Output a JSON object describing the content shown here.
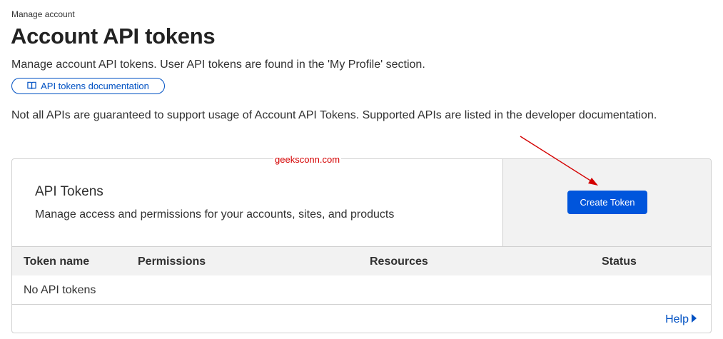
{
  "header": {
    "breadcrumb": "Manage account",
    "title": "Account API tokens",
    "subtitle": "Manage account API tokens. User API tokens are found in the 'My Profile' section.",
    "doc_link_label": "API tokens documentation",
    "doc_link_icon": "book-icon"
  },
  "notice": "Not all APIs are guaranteed to support usage of Account API Tokens. Supported APIs are listed in the developer documentation.",
  "watermark": "geeksconn.com",
  "card": {
    "title": "API Tokens",
    "description": "Manage access and permissions for your accounts, sites, and products",
    "create_button_label": "Create Token",
    "columns": [
      "Token name",
      "Permissions",
      "Resources",
      "Status"
    ],
    "empty_text": "No API tokens",
    "help_label": "Help"
  },
  "colors": {
    "accent": "#0055dc",
    "link": "#0051c3",
    "annotation": "#d40000",
    "panel": "#f2f2f2"
  }
}
